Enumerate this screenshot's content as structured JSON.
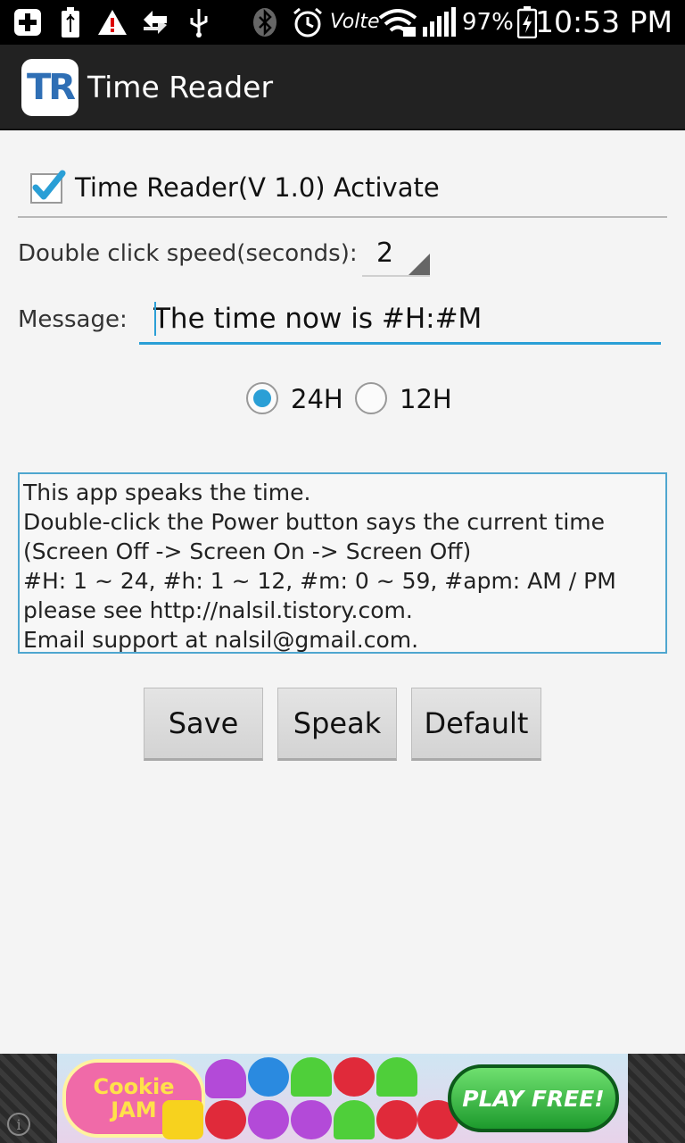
{
  "status_bar": {
    "battery_percent": "97%",
    "time": "10:53 PM",
    "network_label": "Volte",
    "icons": [
      "add-icon",
      "usb-battery-icon",
      "warning-icon",
      "data-transfer-icon",
      "usb-icon",
      "bluetooth-icon",
      "alarm-icon",
      "volte-icon",
      "wifi-icon",
      "signal-icon",
      "battery-icon"
    ]
  },
  "app_bar": {
    "logo_text": "TR",
    "title": "Time Reader"
  },
  "settings": {
    "activate_label": "Time Reader(V 1.0) Activate",
    "activate_checked": true,
    "speed_label": "Double click speed(seconds):",
    "speed_value": "2",
    "message_label": "Message:",
    "message_value": "The time now is #H:#M",
    "format_options": [
      "24H",
      "12H"
    ],
    "format_selected": "24H"
  },
  "info": {
    "lines": [
      "This app speaks the time.",
      "Double-click the Power button says the current time",
      "(Screen Off -> Screen On -> Screen Off)",
      "#H: 1 ~ 24, #h: 1 ~ 12, #m: 0 ~ 59, #apm: AM / PM",
      "please see http://nalsil.tistory.com.",
      "Email support at nalsil@gmail.com."
    ]
  },
  "buttons": {
    "save": "Save",
    "speak": "Speak",
    "default": "Default"
  },
  "ad": {
    "brand": "Cookie JAM",
    "cta": "PLAY FREE!",
    "info_glyph": "i"
  },
  "colors": {
    "accent": "#2a9fd6",
    "action_bar": "#222222",
    "background": "#f4f4f4"
  }
}
